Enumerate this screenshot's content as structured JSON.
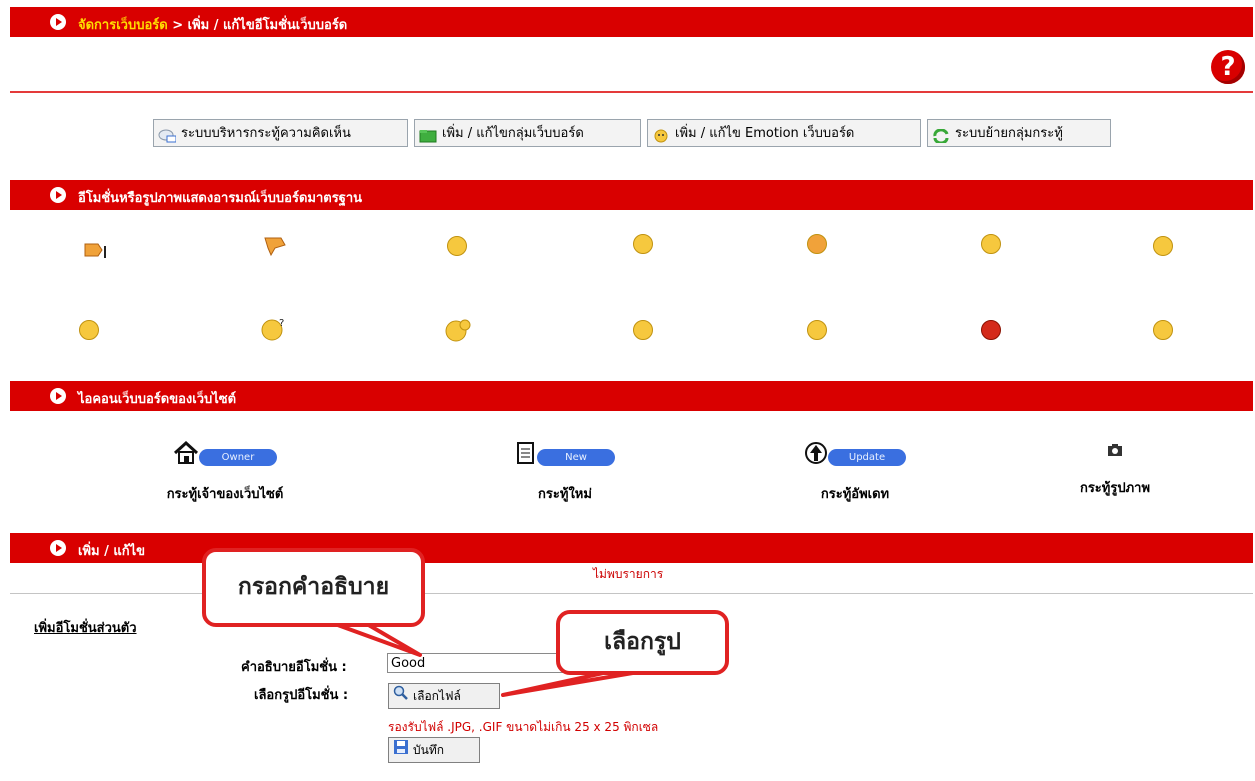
{
  "header": {
    "breadcrumb_link": "จัดการเว็บบอร์ด",
    "breadcrumb_rest": " > เพิ่ม / แก้ไขอีโมชั่นเว็บบอร์ด"
  },
  "toolbar": [
    {
      "label": "ระบบบริหารกระทู้ความคิดเห็น",
      "icon": "comment-mail-icon"
    },
    {
      "label": "เพิ่ม / แก้ไขกลุ่มเว็บบอร์ด",
      "icon": "folder-green-icon"
    },
    {
      "label": "เพิ่ม / แก้ไข Emotion เว็บบอร์ด",
      "icon": "smiley-icon"
    },
    {
      "label": "ระบบย้ายกลุ่มกระทู้",
      "icon": "refresh-arrows-icon"
    }
  ],
  "emotions": {
    "title": "อีโมชั่นหรือรูปภาพแสดงอารมณ์เว็บบอร์ดมาตรฐาน",
    "row1": [
      "thumbs-up-icon",
      "thumbs-down-icon",
      "smiley-icon",
      "smile-icon",
      "surprised-icon",
      "tongue-icon",
      "cool-icon"
    ],
    "row2": [
      "cry-icon",
      "confused-icon",
      "wave-icon",
      "wink-icon",
      "angry-icon",
      "red-face-icon",
      "grin-icon"
    ]
  },
  "site_icons": {
    "title": "ไอคอนเว็บบอร์ดของเว็บไซต์",
    "items": [
      {
        "badge": "Owner",
        "label": "กระทู้เจ้าของเว็บไซต์",
        "icon": "home-icon"
      },
      {
        "badge": "New",
        "label": "กระทู้ใหม่",
        "icon": "document-icon"
      },
      {
        "badge": "Update",
        "label": "กระทู้อัพเดท",
        "icon": "up-arrow-icon"
      },
      {
        "badge": "",
        "label": "กระทู้รูปภาพ",
        "icon": "camera-icon"
      }
    ]
  },
  "custom": {
    "bar_title": "เพิ่ม / แก้ไข",
    "not_found": "ไม่พบรายการ",
    "section_link": "เพิ่มอีโมชั่นส่วนตัว",
    "desc_label": "คำอธิบายอีโมชั่น :",
    "desc_value": "Good",
    "image_label": "เลือกรูปอีโมชั่น :",
    "choose_file": "เลือกไฟล์",
    "hint": "รองรับไฟล์ .JPG, .GIF ขนาดไม่เกิน 25 x 25 พิกเซล",
    "save": "บันทึก"
  },
  "callouts": {
    "describe": "กรอกคำอธิบาย",
    "choose": "เลือกรูป"
  },
  "colors": {
    "bar": "#d90000",
    "link_yellow": "#ffde00",
    "callout_border": "#e02222",
    "hint": "#d10000"
  }
}
